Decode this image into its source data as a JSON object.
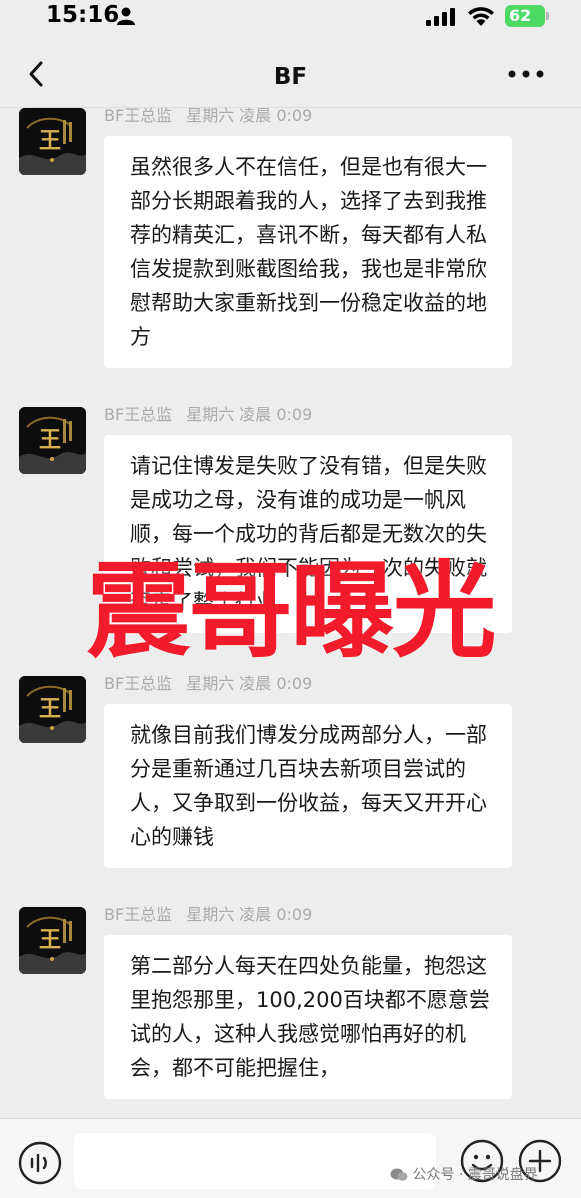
{
  "status_bar": {
    "time": "15:16",
    "battery_level": "62",
    "icons": [
      "person-icon",
      "signal-icon",
      "wifi-icon",
      "battery-icon"
    ]
  },
  "nav": {
    "title": "BF",
    "back_icon": "chevron-left-icon",
    "more_icon": "more-dots-icon"
  },
  "messages": [
    {
      "sender": "BF王总监",
      "time": "星期六 凌晨 0:09",
      "text": "虽然很多人不在信任，但是也有很大一部分长期跟着我的人，选择了去到我推荐的精英汇，喜讯不断，每天都有人私信发提款到账截图给我，我也是非常欣慰帮助大家重新找到一份稳定收益的地方"
    },
    {
      "sender": "BF王总监",
      "time": "星期六 凌晨 0:09",
      "text": "请记住博发是失败了没有错，但是失败是成功之母，没有谁的成功是一帆风顺，每一个成功的背后都是无数次的失败和尝试，我们不能因为一次的失败就否定了整个行业。"
    },
    {
      "sender": "BF王总监",
      "time": "星期六 凌晨 0:09",
      "text": "就像目前我们博发分成两部分人，一部分是重新通过几百块去新项目尝试的人，又争取到一份收益，每天又开开心心的赚钱"
    },
    {
      "sender": "BF王总监",
      "time": "星期六 凌晨 0:09",
      "text": "第二部分人每天在四处负能量，抱怨这里抱怨那里，100,200百块都不愿意尝试的人，这种人我感觉哪怕再好的机会，都不可能把握住，"
    }
  ],
  "watermark": "震哥曝光",
  "footer": {
    "credit_prefix": "公众号 · ",
    "credit_name": "震哥说盘界"
  },
  "colors": {
    "background": "#ededed",
    "bubble": "#ffffff",
    "watermark": "#f21b2b",
    "battery": "#4cd964"
  }
}
